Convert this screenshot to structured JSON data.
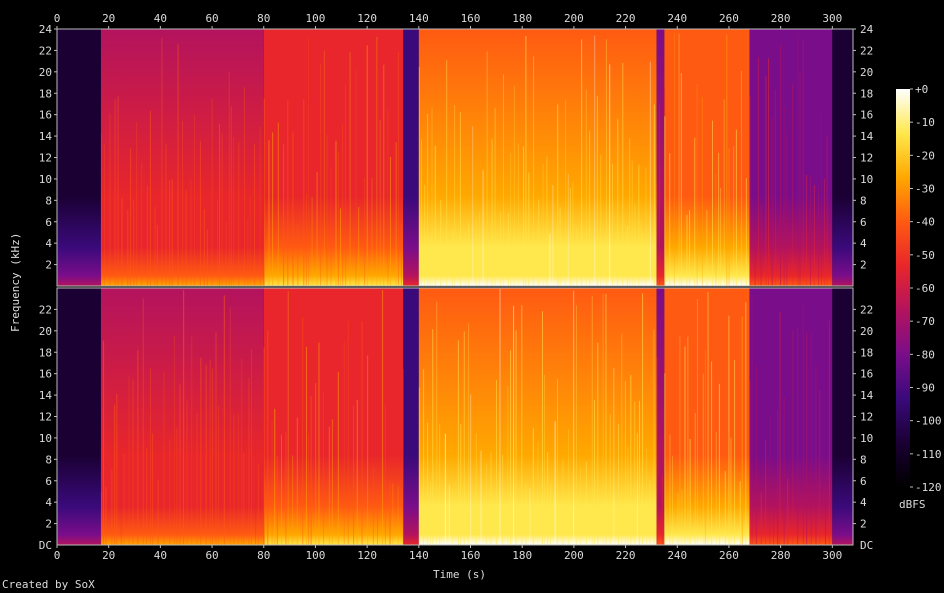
{
  "chart_data": {
    "type": "heatmap",
    "title": "",
    "xlabel": "Time (s)",
    "ylabel": "Frequency (kHz)",
    "colorbar_label": "dBFS",
    "credit": "Created by SoX",
    "channels": 2,
    "x_range": [
      0,
      308
    ],
    "x_ticks": [
      0,
      20,
      40,
      60,
      80,
      100,
      120,
      140,
      160,
      180,
      200,
      220,
      240,
      260,
      280,
      300
    ],
    "y_range_khz": [
      0,
      24
    ],
    "y_ticks": [
      2,
      4,
      6,
      8,
      10,
      12,
      14,
      16,
      18,
      20,
      22,
      24
    ],
    "y_bottom_label": "DC",
    "colorbar_range": [
      -120,
      0
    ],
    "colorbar_ticks": [
      "+0",
      "-10",
      "-20",
      "-30",
      "-40",
      "-50",
      "-60",
      "-70",
      "-80",
      "-90",
      "-100",
      "-110",
      "-120"
    ],
    "colormap": [
      "#000000",
      "#1a0033",
      "#3a0a7a",
      "#7a0d8a",
      "#b3135e",
      "#e8262b",
      "#ff5a12",
      "#ffa800",
      "#ffe84d",
      "#ffffff"
    ],
    "segments": [
      {
        "start": 0,
        "end": 17,
        "level": 0.18
      },
      {
        "start": 17,
        "end": 80,
        "level": 0.55
      },
      {
        "start": 80,
        "end": 134,
        "level": 0.62
      },
      {
        "start": 134,
        "end": 140,
        "level": 0.3
      },
      {
        "start": 140,
        "end": 232,
        "level": 0.82
      },
      {
        "start": 232,
        "end": 235,
        "level": 0.45
      },
      {
        "start": 235,
        "end": 268,
        "level": 0.76
      },
      {
        "start": 268,
        "end": 300,
        "level": 0.4
      },
      {
        "start": 300,
        "end": 308,
        "level": 0.2
      }
    ]
  }
}
